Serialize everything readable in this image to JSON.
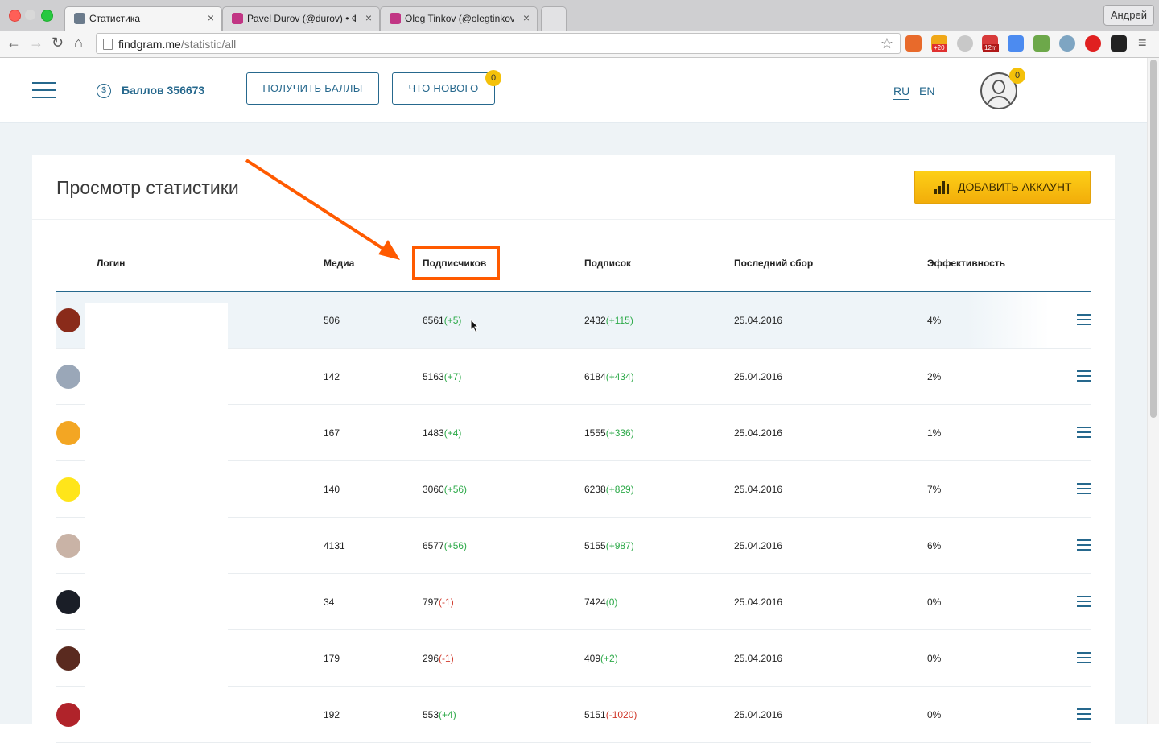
{
  "browser": {
    "tabs": [
      {
        "title": "Статистика",
        "favicon_color": "#6b7b8c"
      },
      {
        "title": "Pavel Durov (@durov) • Фо",
        "favicon_color": "#c13584"
      },
      {
        "title": "Oleg Tinkov (@olegtinkov)",
        "favicon_color": "#c13584"
      }
    ],
    "close_glyph": "×",
    "profile": "Андрей",
    "url_domain": "findgram.me",
    "url_path": "/statistic/all",
    "star_glyph": "☆",
    "back_glyph": "←",
    "forward_glyph": "→",
    "reload_glyph": "↻",
    "home_glyph": "⌂",
    "menu_glyph": "≡",
    "extension_icons": [
      "ext-orange-icon",
      "ext-badge-20-icon",
      "ext-moon-icon",
      "ext-timer-12m-icon",
      "ext-translate-icon",
      "ext-green-icon",
      "ext-drop-icon",
      "ext-power-icon",
      "ext-puzzle-icon"
    ],
    "extension_badges": [
      "+20",
      "12m"
    ]
  },
  "header": {
    "coin_symbol": "$",
    "points_label": "Баллов 356673",
    "get_points_button": "ПОЛУЧИТЬ БАЛЛЫ",
    "whats_new_button": "ЧТО НОВОГО",
    "whats_new_badge": "0",
    "lang_ru": "RU",
    "lang_en": "EN",
    "user_badge": "0"
  },
  "card": {
    "title": "Просмотр статистики",
    "add_account_button": "ДОБАВИТЬ АККАУНТ"
  },
  "table": {
    "columns": [
      "Логин",
      "Медиа",
      "Подписчиков",
      "Подписок",
      "Последний сбор",
      "Эффективность"
    ],
    "rows": [
      {
        "media": "506",
        "followers": "6561",
        "followers_delta": "(+5)",
        "following": "2432",
        "following_delta": "(+115)",
        "last": "25.04.2016",
        "eff": "4%",
        "avatar_color": "#8a2b1a"
      },
      {
        "media": "142",
        "followers": "5163",
        "followers_delta": "(+7)",
        "following": "6184",
        "following_delta": "(+434)",
        "last": "25.04.2016",
        "eff": "2%",
        "avatar_color": "#9aa7b8"
      },
      {
        "media": "167",
        "followers": "1483",
        "followers_delta": "(+4)",
        "following": "1555",
        "following_delta": "(+336)",
        "last": "25.04.2016",
        "eff": "1%",
        "avatar_color": "#f3a623"
      },
      {
        "media": "140",
        "followers": "3060",
        "followers_delta": "(+56)",
        "following": "6238",
        "following_delta": "(+829)",
        "last": "25.04.2016",
        "eff": "7%",
        "avatar_color": "#ffe51a"
      },
      {
        "media": "4131",
        "followers": "6577",
        "followers_delta": "(+56)",
        "following": "5155",
        "following_delta": "(+987)",
        "last": "25.04.2016",
        "eff": "6%",
        "avatar_color": "#c9b3a6"
      },
      {
        "media": "34",
        "followers": "797",
        "followers_delta": "(-1)",
        "following": "7424",
        "following_delta": "(0)",
        "last": "25.04.2016",
        "eff": "0%",
        "avatar_color": "#1a1e27"
      },
      {
        "media": "179",
        "followers": "296",
        "followers_delta": "(-1)",
        "following": "409",
        "following_delta": "(+2)",
        "last": "25.04.2016",
        "eff": "0%",
        "avatar_color": "#5a2a1f"
      },
      {
        "media": "192",
        "followers": "553",
        "followers_delta": "(+4)",
        "following": "5151",
        "following_delta": "(-1020)",
        "last": "25.04.2016",
        "eff": "0%",
        "avatar_color": "#b0232a"
      }
    ]
  },
  "colors": {
    "accent": "#26688d",
    "positive": "#2eaa4a",
    "negative": "#d0392b",
    "highlight": "#ff5a00",
    "button_yellow": "#fdcf17"
  }
}
